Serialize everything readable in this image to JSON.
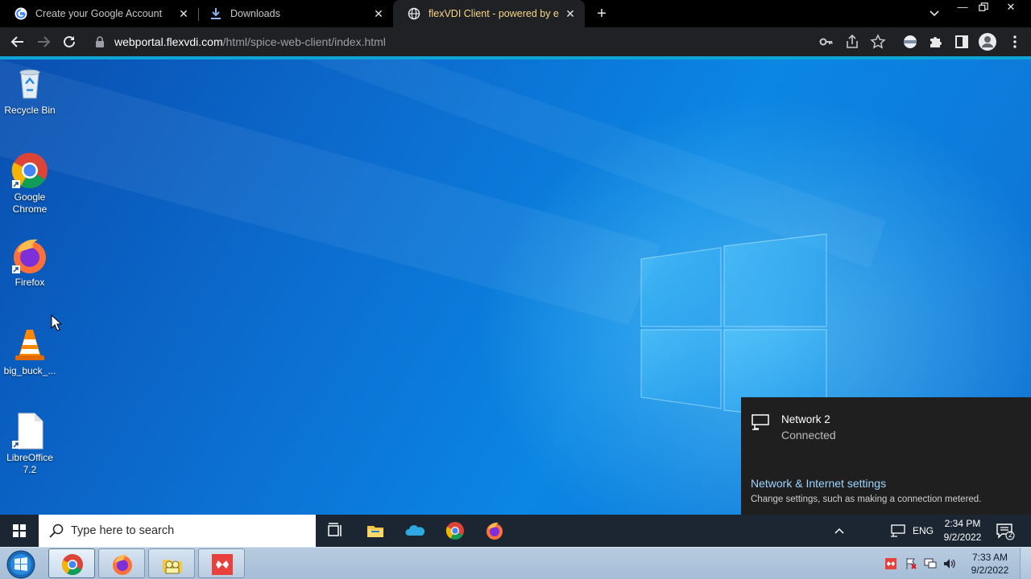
{
  "browser": {
    "tabs": [
      {
        "title": "Create your Google Account",
        "active": false,
        "icon": "google-g-icon"
      },
      {
        "title": "Downloads",
        "active": false,
        "icon": "download-icon"
      },
      {
        "title": "flexVDI Client - powered by eyeOS",
        "active": true,
        "icon": "globe-icon"
      }
    ],
    "url_host": "webportal.flexvdi.com",
    "url_path": "/html/spice-web-client/index.html",
    "accent_color": "#0ea4d8"
  },
  "desktop": {
    "icons": [
      {
        "label": "Recycle Bin",
        "icon": "recycle-bin-icon"
      },
      {
        "label": "Google Chrome",
        "icon": "chrome-icon"
      },
      {
        "label": "Firefox",
        "icon": "firefox-icon"
      },
      {
        "label": "big_buck_...",
        "icon": "vlc-icon"
      },
      {
        "label": "LibreOffice 7.2",
        "icon": "libreoffice-icon"
      }
    ]
  },
  "network_flyout": {
    "network_name": "Network 2",
    "status": "Connected",
    "settings_link": "Network & Internet settings",
    "settings_desc": "Change settings, such as making a connection metered."
  },
  "remote_taskbar": {
    "search_placeholder": "Type here to search",
    "language": "ENG",
    "time": "2:34 PM",
    "date": "9/2/2022",
    "notification_count": "2"
  },
  "host_taskbar": {
    "time": "7:33 AM",
    "date": "9/2/2022"
  }
}
